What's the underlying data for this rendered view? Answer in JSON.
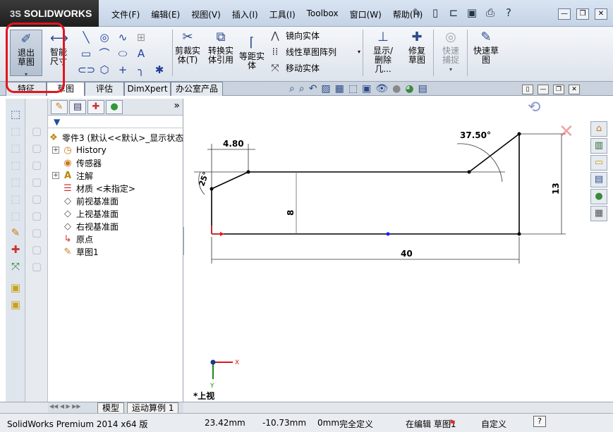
{
  "app": {
    "brand_prefix": "3S",
    "brand_name": "SOLIDWORKS"
  },
  "menu": [
    "文件(F)",
    "编辑(E)",
    "视图(V)",
    "插入(I)",
    "工具(I)",
    "Toolbox",
    "窗口(W)",
    "帮助(H)"
  ],
  "ribbon": {
    "exit_sketch": "退出草图",
    "smart_dim": "智能尺寸",
    "trim": "剪裁实体(T)",
    "convert": "转换实体引用",
    "offset": "等距实体",
    "mirror": "镜向实体",
    "linear_pattern": "线性草图阵列",
    "move": "移动实体",
    "show_delete": "显示/删除几...",
    "repair": "修复草图",
    "quick_snap": "快速捕捉",
    "rapid_sketch": "快速草图"
  },
  "tabs": [
    "特征",
    "草图",
    "评估",
    "DimXpert",
    "办公室产品"
  ],
  "tree": {
    "root": "零件3 (默认<<默认>_显示状态",
    "items": [
      {
        "label": "History",
        "icon": "history-icon",
        "expandable": true
      },
      {
        "label": "传感器",
        "icon": "sensor-icon",
        "expandable": false
      },
      {
        "label": "注解",
        "icon": "annotation-icon",
        "expandable": true
      },
      {
        "label": "材质 <未指定>",
        "icon": "material-icon",
        "expandable": false
      },
      {
        "label": "前视基准面",
        "icon": "plane-icon",
        "expandable": false
      },
      {
        "label": "上视基准面",
        "icon": "plane-icon",
        "expandable": false
      },
      {
        "label": "右视基准面",
        "icon": "plane-icon",
        "expandable": false
      },
      {
        "label": "原点",
        "icon": "origin-icon",
        "expandable": false
      },
      {
        "label": "草图1",
        "icon": "sketch-icon",
        "expandable": false
      }
    ]
  },
  "drawing": {
    "dim_top": "4.80",
    "dim_angle_left": "25°",
    "dim_angle_right": "37.50°",
    "dim_inner": "8",
    "dim_right": "13",
    "dim_bottom": "40",
    "view_label": "*上视",
    "axis_x": "X",
    "axis_y": "Y"
  },
  "sheet_tabs": [
    "模型",
    "运动算例 1"
  ],
  "status": {
    "app_version": "SolidWorks Premium 2014 x64 版",
    "x": "23.42mm",
    "y": "-10.73mm",
    "z": "0mm",
    "defined": "完全定义",
    "editing": "在编辑 草图1",
    "custom": "自定义"
  },
  "colors": {
    "sketch_line": "#000000",
    "highlight": "#e4141c",
    "midpoint": "#1a1aff"
  }
}
